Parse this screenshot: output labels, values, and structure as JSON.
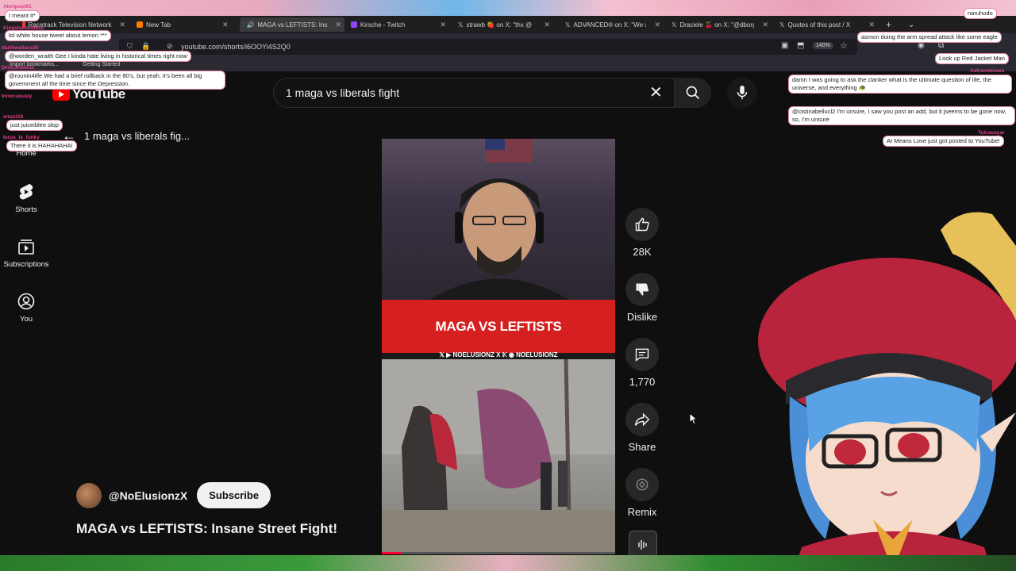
{
  "browser": {
    "tabs": [
      {
        "label": "Racetrack Television Network"
      },
      {
        "label": "New Tab"
      },
      {
        "label": "MAGA vs LEFTISTS: Ins"
      },
      {
        "label": "Kirsche - Twitch"
      },
      {
        "label": "strawb 🍓 on X: \"thx @"
      },
      {
        "label": "ADVANCED® on X: \"We w"
      },
      {
        "label": "Draciele 🍒 on X: \"@dborg"
      },
      {
        "label": "Quotes of this post / X"
      }
    ],
    "url": "youtube.com/shorts/i6OOYi4S2Q0",
    "zoom": "140%",
    "bookmarks": [
      "Import bookmarks...",
      "Getting Started"
    ]
  },
  "youtube": {
    "logo": "YouTube",
    "search_query": "1 maga vs liberals fight",
    "back_title": "1 maga vs liberals fig...",
    "sidebar": [
      {
        "label": "Home",
        "icon": "home-icon"
      },
      {
        "label": "Shorts",
        "icon": "shorts-icon"
      },
      {
        "label": "Subscriptions",
        "icon": "subscriptions-icon"
      },
      {
        "label": "You",
        "icon": "you-icon"
      }
    ],
    "video": {
      "banner": "MAGA VS LEFTISTS",
      "handles": "𝕏 ▶ NOELUSIONZ X 𝕂 ◉ NOELUSIONZ",
      "progress": 0.08
    },
    "actions": {
      "like": "28K",
      "dislike": "Dislike",
      "comments": "1,770",
      "share": "Share",
      "remix": "Remix"
    },
    "channel": "@NoElusionzX",
    "subscribe": "Subscribe",
    "title": "MAGA vs LEFTISTS: Insane Street Fight!"
  },
  "chat_left": [
    {
      "user": "Alertpoet91",
      "text": "I meant it*"
    },
    {
      "user": "KingsIsLoveless",
      "text": "lol white house tweet about lemon ***"
    },
    {
      "user": "darthwallace25",
      "text": "@worden_wraith Gee I kinda hate living in historical times right now"
    },
    {
      "user": "DrinLimeIcus",
      "text": "@rounin4life We had a brief rollback in the 80's, but yeah, it's been all big government all the time since the Depression."
    },
    {
      "user": "Innocuously",
      "text": ""
    },
    {
      "user": "emzzt16",
      "text": "just juiceiblee slop"
    },
    {
      "user": "Iurus_le_funky",
      "text": "There it is HAHAHAHA!"
    }
  ],
  "chat_right": [
    {
      "user": "naruhodo",
      "text": ""
    },
    {
      "user": "",
      "text": "asmon doing the arm spread attack like some eagle"
    },
    {
      "user": "",
      "text": "Look up Red Jacket Man"
    },
    {
      "user": "Astronomises",
      "text": "damn I was going to ask the clanker what is the ultimate question of life, the universe, and everything 🐢"
    },
    {
      "user": "",
      "text": "@cistinabellucl2 I'm unsure, I saw you post an add, but it jseems to be gone now, so, I'm unsure"
    },
    {
      "user": "Tulcavayar",
      "text": "AI Means Love just got posted to YouTube!"
    }
  ]
}
